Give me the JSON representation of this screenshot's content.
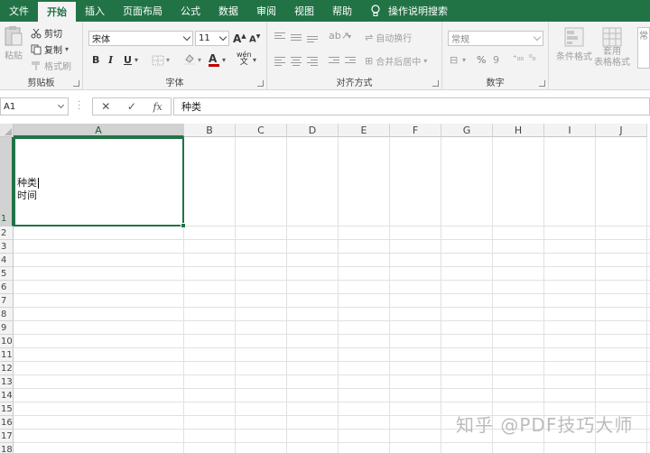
{
  "tabs": {
    "file": "文件",
    "home": "开始",
    "insert": "插入",
    "layout": "页面布局",
    "formulas": "公式",
    "data": "数据",
    "review": "审阅",
    "view": "视图",
    "help": "帮助",
    "search": "操作说明搜索"
  },
  "ribbon": {
    "clipboard": {
      "paste": "粘贴",
      "cut": "剪切",
      "copy": "复制",
      "format_painter": "格式刷",
      "label": "剪贴板"
    },
    "font": {
      "font_name": "宋体",
      "font_size": "11",
      "grow": "A",
      "shrink": "A",
      "bold": "B",
      "italic": "I",
      "underline": "U",
      "font_color": "A",
      "phonetic": "wén",
      "label": "字体"
    },
    "alignment": {
      "wrap_text": "自动换行",
      "merge_center": "合并后居中",
      "label": "对齐方式"
    },
    "number": {
      "format": "常规",
      "percent": "%",
      "comma": "9",
      "label": "数字"
    },
    "styles": {
      "conditional": "条件格式",
      "table_line1": "套用",
      "table_line2": "表格格式",
      "cell_styles_partial": "常"
    }
  },
  "formula_bar": {
    "name_box": "A1",
    "cancel": "✕",
    "enter": "✓",
    "fx": "fx",
    "content": "种类"
  },
  "grid": {
    "columns": [
      "A",
      "B",
      "C",
      "D",
      "E",
      "F",
      "G",
      "H",
      "I",
      "J"
    ],
    "rows": [
      "1",
      "2",
      "3",
      "4",
      "5",
      "6",
      "7",
      "8",
      "9",
      "10",
      "11",
      "12",
      "13",
      "14",
      "15",
      "16",
      "17",
      "18"
    ],
    "a1_line1": "种类",
    "a1_line2": "时间"
  },
  "watermark": "知乎 @PDF技巧大师",
  "colors": {
    "accent": "#217346",
    "ribbon_bg": "#f3f3f3"
  }
}
